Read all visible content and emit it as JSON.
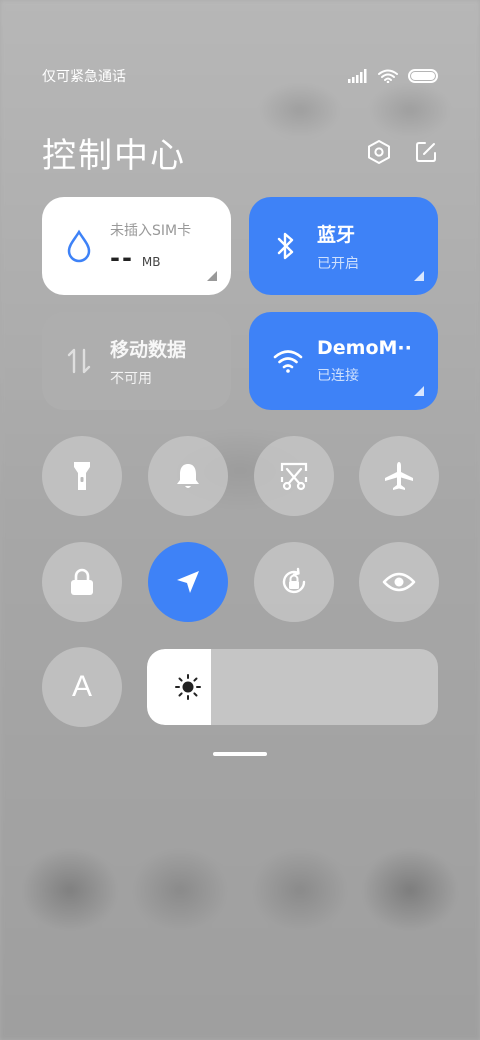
{
  "status_bar": {
    "carrier_text": "仅可紧急通话",
    "battery_level": 1.0
  },
  "header": {
    "title": "控制中心"
  },
  "tiles": {
    "sim": {
      "label": "未插入SIM卡",
      "value": "--",
      "unit": "MB"
    },
    "bluetooth": {
      "label": "蓝牙",
      "status": "已开启"
    },
    "mobile_data": {
      "label": "移动数据",
      "status": "不可用"
    },
    "wifi": {
      "label": "DemoM··",
      "status": "已连接"
    }
  },
  "toggles": [
    {
      "name": "flashlight",
      "active": false
    },
    {
      "name": "bell",
      "active": false
    },
    {
      "name": "screenshot",
      "active": false
    },
    {
      "name": "airplane",
      "active": false
    },
    {
      "name": "lock",
      "active": false
    },
    {
      "name": "location",
      "active": true
    },
    {
      "name": "rotation-lock",
      "active": false
    },
    {
      "name": "eye",
      "active": false
    }
  ],
  "font_toggle_label": "A",
  "brightness": {
    "level": 0.22
  },
  "colors": {
    "accent": "#3e82f7",
    "tile_white": "#ffffff",
    "water_icon": "#3e82f7"
  }
}
